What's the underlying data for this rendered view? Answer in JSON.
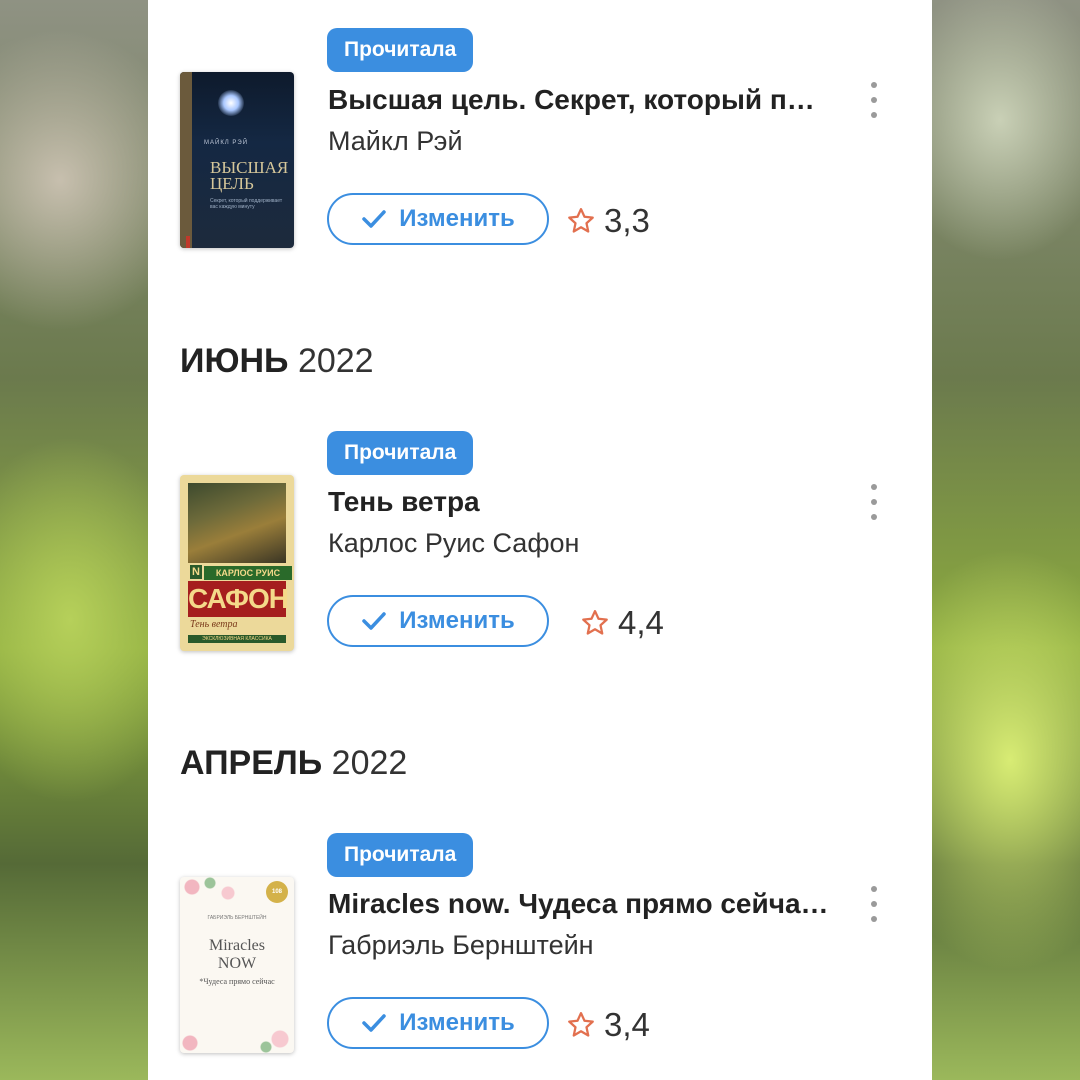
{
  "books": [
    {
      "status": "Прочитала",
      "title": "Высшая цель. Секрет, который п…",
      "author": "Майкл Рэй",
      "change_label": "Изменить",
      "rating": "3,3",
      "cover": {
        "top_text": "МАЙКЛ РЭЙ",
        "big_text": "ВЫСШАЯ ЦЕЛЬ",
        "small_text": "Секрет, который поддерживает вас каждую минуту"
      }
    },
    {
      "status": "Прочитала",
      "title": "Тень ветра",
      "author": "Карлос Руис Сафон",
      "change_label": "Изменить",
      "rating": "4,4",
      "cover": {
        "n": "N",
        "author_line": "КАРЛОС РУИС",
        "surname": "САФОН",
        "book_title": "Тень ветра",
        "footer": "ЭКСКЛЮЗИВНАЯ КЛАССИКА"
      }
    },
    {
      "status": "Прочитала",
      "title": "Miracles now. Чудеса прямо сейча…",
      "author": "Габриэль Бернштейн",
      "change_label": "Изменить",
      "rating": "3,4",
      "cover": {
        "author_line": "ГАБРИЭЛЬ БЕРНШТЕЙН",
        "line1": "Miracles",
        "line2": "NOW",
        "line3": "*Чудеса прямо сейчас",
        "badge": "108"
      }
    }
  ],
  "months": [
    {
      "name": "ИЮНЬ",
      "year": "2022"
    },
    {
      "name": "АПРЕЛЬ",
      "year": "2022"
    }
  ],
  "colors": {
    "accent": "#3b8ee0",
    "star": "#e2704f"
  },
  "icons": {
    "check": "check-icon",
    "star": "star-outline-icon",
    "more": "more-vertical-icon"
  }
}
